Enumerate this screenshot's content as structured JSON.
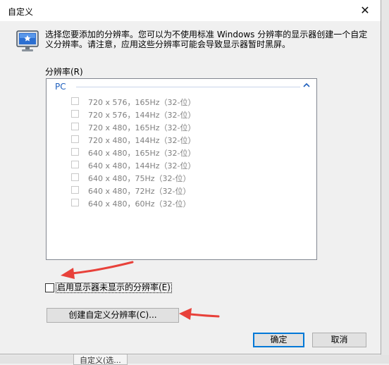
{
  "dialog": {
    "title": "自定义",
    "close_glyph": "✕",
    "intro": "选择您要添加的分辨率。您可以为不使用标准 Windows 分辨率的显示器创建一个自定义分辨率。请注意，应用这些分辨率可能会导致显示器暂时黑屏。"
  },
  "resolutions": {
    "label": "分辨率(R)",
    "group": {
      "label": "PC",
      "chevron": "^"
    },
    "items": [
      {
        "text": "720 x 576，165Hz（32-位）",
        "checked": false
      },
      {
        "text": "720 x 576，144Hz（32-位）",
        "checked": false
      },
      {
        "text": "720 x 480，165Hz（32-位）",
        "checked": false
      },
      {
        "text": "720 x 480，144Hz（32-位）",
        "checked": false
      },
      {
        "text": "640 x 480，165Hz（32-位）",
        "checked": false
      },
      {
        "text": "640 x 480，144Hz（32-位）",
        "checked": false
      },
      {
        "text": "640 x 480，75Hz（32-位）",
        "checked": false
      },
      {
        "text": "640 x 480，72Hz（32-位）",
        "checked": false
      },
      {
        "text": "640 x 480，60Hz（32-位）",
        "checked": false
      }
    ]
  },
  "enable_option": {
    "label": "启用显示器未显示的分辨率(E)",
    "checked": false
  },
  "buttons": {
    "create": "创建自定义分辨率(C)...",
    "ok": "确定",
    "cancel": "取消"
  },
  "background": {
    "partial_text": "自定义(选..."
  },
  "annotations": {
    "arrow_color": "#e8413a"
  }
}
